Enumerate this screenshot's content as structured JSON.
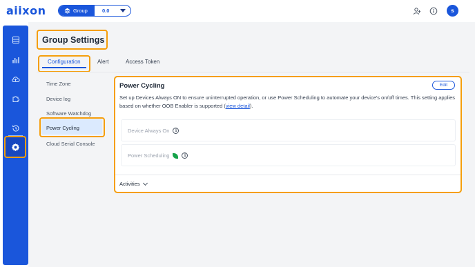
{
  "header": {
    "logo": "aiixon",
    "group_selector": {
      "label": "Group",
      "version": "0.0"
    },
    "icons": [
      "add-user-icon",
      "info-icon"
    ],
    "avatar_initial": "s"
  },
  "sidebar": {
    "items": [
      {
        "icon": "devices-icon"
      },
      {
        "icon": "analytics-icon"
      },
      {
        "icon": "cloud-upload-icon"
      },
      {
        "icon": "puzzle-icon"
      },
      {
        "icon": "ota-update-icon"
      },
      {
        "icon": "settings-icon",
        "active": true
      }
    ]
  },
  "page": {
    "title": "Group Settings",
    "tabs": [
      {
        "label": "Configuration",
        "active": true
      },
      {
        "label": "Alert"
      },
      {
        "label": "Access Token"
      }
    ],
    "sidenav": [
      {
        "label": "Time Zone"
      },
      {
        "label": "Device log"
      },
      {
        "label": "Software Watchdog"
      },
      {
        "label": "Power Cycling",
        "active": true
      },
      {
        "label": "Cloud Serial Console"
      }
    ]
  },
  "panel": {
    "title": "Power Cycling",
    "edit_label": "Edit",
    "description": "Set up Devices Always ON to ensure uninterrupted operation, or use Power Scheduling to automate your device's on/off times. This setting applies based on whether OOB Enabler is supported (",
    "description_link": "view detail",
    "description_end": ").",
    "rows": [
      {
        "label": "Device Always On"
      },
      {
        "label": "Power Scheduling"
      }
    ],
    "activities_label": "Activities"
  },
  "colors": {
    "brand": "#1a56db",
    "highlight": "#f59e0b",
    "active_bg": "#dbeafe"
  }
}
